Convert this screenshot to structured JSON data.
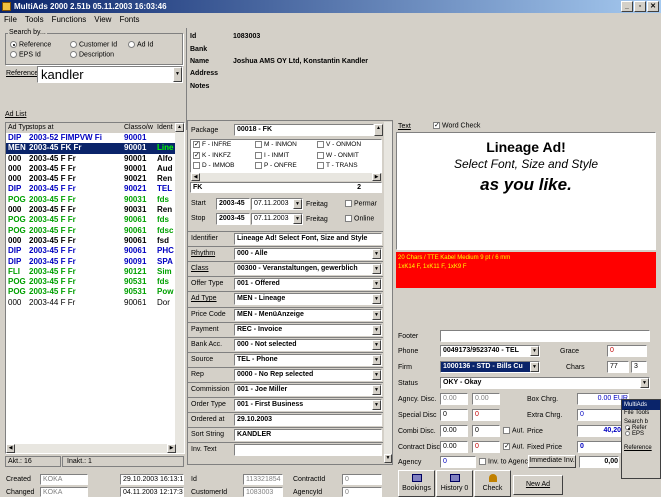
{
  "window": {
    "title": "MultiAds 2000 2.51b 05.11.2003 16:03:46"
  },
  "menu": [
    "File",
    "Tools",
    "Functions",
    "View",
    "Fonts"
  ],
  "search": {
    "group_label": "Search by...",
    "opt_reference": "Reference",
    "opt_customer_id": "Customer Id",
    "opt_ad_id": "Ad Id",
    "opt_eps_id": "EPS Id",
    "opt_description": "Description",
    "reference_label": "Reference",
    "reference_value": "kandler"
  },
  "customer": {
    "id_label": "Id",
    "id_value": "1083003",
    "bank_label": "Bank",
    "name_label": "Name",
    "name_value": "Joshua AMS OY Ltd, Konstantin Kandler",
    "address_label": "Address",
    "notes_label": "Notes"
  },
  "adlist": {
    "title": "Ad List",
    "headers": [
      "Ad Typ",
      "stops at",
      "Class",
      "o/w",
      "Ident"
    ],
    "rows": [
      {
        "typ": "DIP",
        "stops": "2003-52 FIMPVW Fi",
        "cls": "9000",
        "ow": "1",
        "ident": "",
        "color": "#0000c0",
        "sel": false
      },
      {
        "typ": "MEN",
        "stops": "2003-45 FK Fr",
        "cls": "9000",
        "ow": "1",
        "ident": "Line",
        "color": "#00a000",
        "sel": true
      },
      {
        "typ": "000",
        "stops": "2003-45 F Fr",
        "cls": "9000",
        "ow": "1",
        "ident": "Alfo",
        "color": "#000000",
        "sel": false
      },
      {
        "typ": "000",
        "stops": "2003-45 F Fr",
        "cls": "9000",
        "ow": "1",
        "ident": "Aud",
        "color": "#000000",
        "sel": false
      },
      {
        "typ": "000",
        "stops": "2003-45 F Fr",
        "cls": "9002",
        "ow": "1",
        "ident": "Ren",
        "color": "#000000",
        "sel": false
      },
      {
        "typ": "DIP",
        "stops": "2003-45 F Fr",
        "cls": "9002",
        "ow": "1",
        "ident": "TEL",
        "color": "#0000c0",
        "sel": false
      },
      {
        "typ": "POG",
        "stops": "2003-45 F Fr",
        "cls": "9003",
        "ow": "1",
        "ident": "fds",
        "color": "#00a000",
        "sel": false
      },
      {
        "typ": "000",
        "stops": "2003-45 F Fr",
        "cls": "9003",
        "ow": "1",
        "ident": "Ren",
        "color": "#000000",
        "sel": false
      },
      {
        "typ": "POG",
        "stops": "2003-45 F Fr",
        "cls": "9006",
        "ow": "1",
        "ident": "fds",
        "color": "#00a000",
        "sel": false
      },
      {
        "typ": "POG",
        "stops": "2003-45 F Fr",
        "cls": "9006",
        "ow": "1",
        "ident": "fdsc",
        "color": "#00a000",
        "sel": false
      },
      {
        "typ": "000",
        "stops": "2003-45 F Fr",
        "cls": "9006",
        "ow": "1",
        "ident": "fsd",
        "color": "#000000",
        "sel": false
      },
      {
        "typ": "DIP",
        "stops": "2003-45 F Fr",
        "cls": "9006",
        "ow": "1",
        "ident": "PHC",
        "color": "#0000c0",
        "sel": false
      },
      {
        "typ": "DIP",
        "stops": "2003-45 F Fr",
        "cls": "9009",
        "ow": "1",
        "ident": "SPA",
        "color": "#0000c0",
        "sel": false
      },
      {
        "typ": "FLI",
        "stops": "2003-45 F Fr",
        "cls": "9012",
        "ow": "1",
        "ident": "Sim",
        "color": "#00a000",
        "sel": false
      },
      {
        "typ": "POG",
        "stops": "2003-45 F Fr",
        "cls": "9053",
        "ow": "1",
        "ident": "fds",
        "color": "#00a000",
        "sel": false
      },
      {
        "typ": "POG",
        "stops": "2003-45 F Fr",
        "cls": "9053",
        "ow": "1",
        "ident": "Pow",
        "color": "#00a000",
        "sel": false
      },
      {
        "typ": "000",
        "stops": "2003-44 F Fr",
        "cls": "9006",
        "ow": "1",
        "ident": "Dor",
        "color": "#000000",
        "sel": false
      }
    ],
    "akt": "Akt.: 16",
    "inakt": "Inakt.: 1"
  },
  "package": {
    "label": "Package",
    "value": "00018 - FK",
    "options": [
      [
        "F - INFRE",
        "M - INMON",
        "V - ONMON"
      ],
      [
        "K - INKFZ",
        "I - INMIT",
        "W - ONMIT"
      ],
      [
        "D - IMMOB",
        "P - ONFRE",
        "T - TRANS"
      ]
    ],
    "checked": [
      "F - INFRE",
      "K - INKFZ"
    ],
    "summary": "FK",
    "count": "2",
    "start_label": "Start",
    "start_week": "2003-45",
    "start_date": "07.11.2003",
    "start_day": "Freitag",
    "start_check": "Permar",
    "stop_label": "Stop",
    "stop_week": "2003-45",
    "stop_date": "07.11.2003",
    "stop_day": "Freitag",
    "stop_check": "Online"
  },
  "adform": [
    {
      "label": "Identifier",
      "value": "Lineage Ad! Select Font, Size and Style",
      "combo": false
    },
    {
      "label": "Rhythm",
      "value": "000 - Alle",
      "combo": true
    },
    {
      "label": "Class",
      "value": "00300 - Veranstaltungen, gewerblich",
      "combo": true
    },
    {
      "label": "Offer Type",
      "value": "001 - Offered",
      "combo": true
    },
    {
      "label": "Ad Type",
      "value": "MEN - Lineage",
      "combo": true
    },
    {
      "label": "Price Code",
      "value": "MEN - MenüAnzeige",
      "combo": true
    },
    {
      "label": "Payment",
      "value": "REC - Invoice",
      "combo": true
    },
    {
      "label": "Bank Acc.",
      "value": "000 - Not selected",
      "combo": true
    },
    {
      "label": "Source",
      "value": "TEL - Phone",
      "combo": true
    },
    {
      "label": "Rep",
      "value": "0000 - No Rep selected",
      "combo": true
    },
    {
      "label": "Commission",
      "value": "001 - Joe Miller",
      "combo": true
    },
    {
      "label": "Order Type",
      "value": "001 - First Business",
      "combo": true
    },
    {
      "label": "Ordered at",
      "value": "29.10.2003",
      "combo": false
    },
    {
      "label": "Sort String",
      "value": "KANDLER",
      "combo": false
    },
    {
      "label": "Inv. Text",
      "value": "",
      "combo": false
    }
  ],
  "text": {
    "label": "Text",
    "wordcheck": "Word Check",
    "line1": "Lineage Ad!",
    "line2": "Select Font, Size and Style",
    "line3": "as you like.",
    "info1": "20 Chars / TTE Kabel Medium 9 pt / 6 mm",
    "info2": "1xK14 F, 1xK11 F, 1xK9 F"
  },
  "pricing": {
    "footer_label": "Footer",
    "phone_label": "Phone",
    "phone_value": "0049173/9523740 - TEL",
    "grace_label": "Grace",
    "grace_value": "0",
    "firm_label": "Firm",
    "firm_value": "1000136 - STD - Bills Cu",
    "chars_label": "Chars",
    "chars_value": "77",
    "chars_value2": "3",
    "status_label": "Status",
    "status_value": "OKY - Okay",
    "agency_disc_label": "Agncy. Disc.",
    "agency_disc_1": "0.00",
    "agency_disc_2": "0.00",
    "box_label": "Box Chrg.",
    "box_value": "0.00 EUR",
    "special_label": "Special Disc",
    "special_1": "0",
    "special_2": "0",
    "extra_label": "Extra Chrg.",
    "extra_value": "0",
    "combi_label": "Combi Disc.",
    "combi_1": "0.00",
    "combi_2": "0",
    "aut1": "Aut.",
    "price_label": "Price",
    "price_value": "40,20",
    "contract_label": "Contract Disc",
    "contract_1": "0.00",
    "contract_2": "0",
    "aut2": "Aut.",
    "fixed_label": "Fixed Price",
    "fixed_value": "0",
    "agency_label": "Agency",
    "agency_value": "0",
    "inv_agency": "Inv. to Agency",
    "immediate": "Immediate Inv.",
    "immediate_value": "0,00"
  },
  "mini": {
    "title": "MultiAds",
    "menu": "File  Tools",
    "search": "Search b",
    "ref": "Refer",
    "eps": "EPS",
    "reference": "Reference"
  },
  "footer": {
    "created_label": "Created",
    "created_user": "KOKA",
    "created_date": "29.10.2003 16:13:1",
    "changed_label": "Changed",
    "changed_user": "KOKA",
    "changed_date": "04.11.2003 12:17:3",
    "id_label": "Id",
    "id_value": "113321854",
    "contract_label": "ContractId",
    "contract_value": "0",
    "customer_label": "CustomerId",
    "customer_value": "1083003",
    "agency_label": "AgencyId",
    "agency_value": "0",
    "btn_bookings": "Bookings",
    "btn_history": "History 0",
    "btn_check": "Check",
    "btn_newad": "New Ad"
  }
}
